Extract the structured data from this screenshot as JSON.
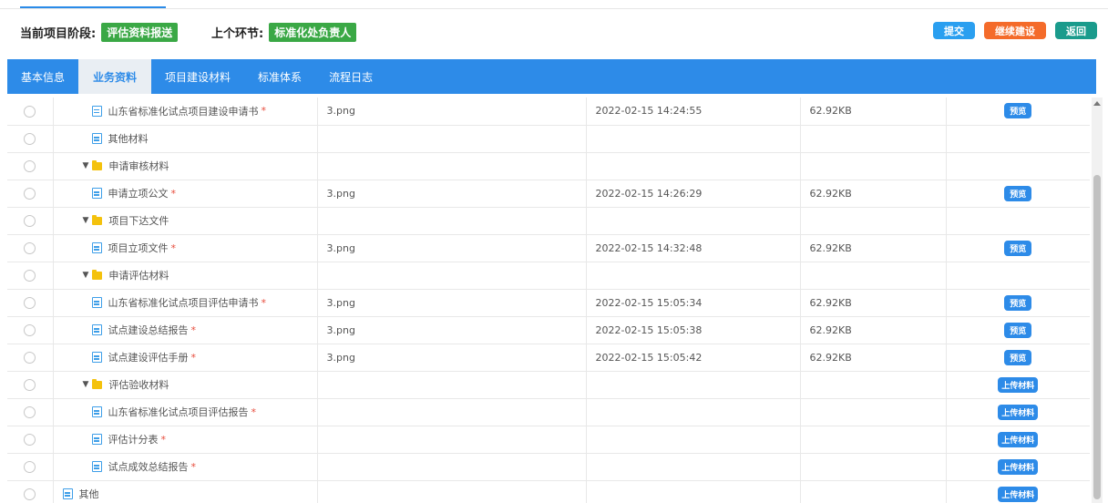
{
  "stage": {
    "current_label": "当前项目阶段:",
    "current_value": "评估资料报送",
    "previous_label": "上个环节:",
    "previous_value": "标准化处负责人"
  },
  "actions": {
    "submit": "提交",
    "continue_build": "继续建设",
    "back": "返回"
  },
  "tabs": [
    {
      "label": "基本信息",
      "active": false
    },
    {
      "label": "业务资料",
      "active": true
    },
    {
      "label": "项目建设材料",
      "active": false
    },
    {
      "label": "标准体系",
      "active": false
    },
    {
      "label": "流程日志",
      "active": false
    }
  ],
  "buttons": {
    "preview": "预览",
    "upload": "上传材料"
  },
  "rows": [
    {
      "type": "file",
      "name": "山东省标准化试点项目建设申请书",
      "required": true,
      "file": "3.png",
      "time": "2022-02-15 14:24:55",
      "size": "62.92KB",
      "action": "预览"
    },
    {
      "type": "file",
      "name": "其他材料",
      "required": false,
      "file": "",
      "time": "",
      "size": "",
      "action": ""
    },
    {
      "type": "folder",
      "name": "申请审核材料",
      "required": false,
      "file": "",
      "time": "",
      "size": "",
      "action": ""
    },
    {
      "type": "file",
      "name": "申请立项公文",
      "required": true,
      "file": "3.png",
      "time": "2022-02-15 14:26:29",
      "size": "62.92KB",
      "action": "预览"
    },
    {
      "type": "folder",
      "name": "项目下达文件",
      "required": false,
      "file": "",
      "time": "",
      "size": "",
      "action": ""
    },
    {
      "type": "file",
      "name": "项目立项文件",
      "required": true,
      "file": "3.png",
      "time": "2022-02-15 14:32:48",
      "size": "62.92KB",
      "action": "预览"
    },
    {
      "type": "folder",
      "name": "申请评估材料",
      "required": false,
      "file": "",
      "time": "",
      "size": "",
      "action": ""
    },
    {
      "type": "file",
      "name": "山东省标准化试点项目评估申请书",
      "required": true,
      "file": "3.png",
      "time": "2022-02-15 15:05:34",
      "size": "62.92KB",
      "action": "预览"
    },
    {
      "type": "file",
      "name": "试点建设总结报告",
      "required": true,
      "file": "3.png",
      "time": "2022-02-15 15:05:38",
      "size": "62.92KB",
      "action": "预览"
    },
    {
      "type": "file",
      "name": "试点建设评估手册",
      "required": true,
      "file": "3.png",
      "time": "2022-02-15 15:05:42",
      "size": "62.92KB",
      "action": "预览"
    },
    {
      "type": "folder",
      "name": "评估验收材料",
      "required": false,
      "file": "",
      "time": "",
      "size": "",
      "action": "上传材料"
    },
    {
      "type": "file",
      "name": "山东省标准化试点项目评估报告",
      "required": true,
      "file": "",
      "time": "",
      "size": "",
      "action": "上传材料"
    },
    {
      "type": "file",
      "name": "评估计分表",
      "required": true,
      "file": "",
      "time": "",
      "size": "",
      "action": "上传材料"
    },
    {
      "type": "file",
      "name": "试点成效总结报告",
      "required": true,
      "file": "",
      "time": "",
      "size": "",
      "action": "上传材料"
    },
    {
      "type": "root-file",
      "name": "其他",
      "required": false,
      "file": "",
      "time": "",
      "size": "",
      "action": "上传材料"
    }
  ]
}
